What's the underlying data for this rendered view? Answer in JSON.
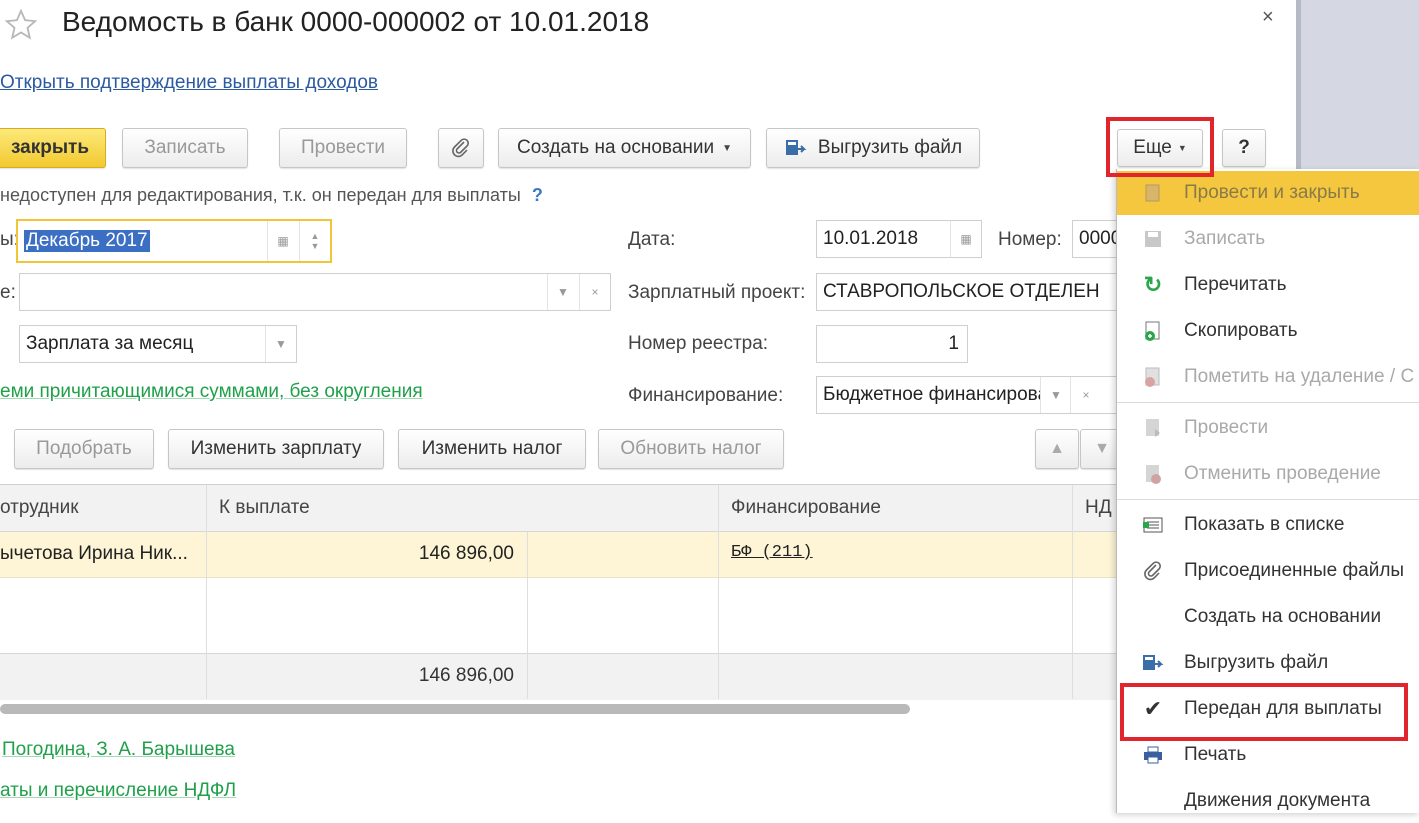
{
  "window": {
    "title": "Ведомость в банк 0000-000002 от 10.01.2018",
    "close_glyph": "×",
    "open_confirmation_link": "Открыть подтверждение выплаты доходов"
  },
  "toolbar": {
    "post_close": "закрыть",
    "save": "Записать",
    "post": "Провести",
    "create_based": "Создать на основании",
    "export_file": "Выгрузить файл",
    "more": "Еще",
    "help": "?"
  },
  "notice": {
    "text": "недоступен для редактирования, т.к. он передан для выплаты",
    "help": "?"
  },
  "form": {
    "period_label": "ы:",
    "period_value": "Декабрь 2017",
    "date_label": "Дата:",
    "date_value": "10.01.2018",
    "number_label": "Номер:",
    "number_value": "0000",
    "org_label": "е:",
    "salary_project_label": "Зарплатный проект:",
    "salary_project_value": "СТАВРОПОЛЬСКОЕ ОТДЕЛЕН",
    "payment_type_value": "Зарплата за месяц",
    "registry_label": "Номер реестра:",
    "registry_value": "1",
    "amounts_link": "еми причитающимися суммами, без округления",
    "financing_label": "Финансирование:",
    "financing_value": "Бюджетное финансирова"
  },
  "table_toolbar": {
    "pick": "Подобрать",
    "change_salary": "Изменить зарплату",
    "change_tax": "Изменить налог",
    "update_tax": "Обновить налог"
  },
  "table": {
    "headers": [
      "отрудник",
      "К выплате",
      "Финансирование",
      "НД"
    ],
    "rows": [
      {
        "employee": "ычетова Ирина Ник...",
        "amount": "146 896,00",
        "financing": "БФ (211)"
      }
    ],
    "total": "146 896,00"
  },
  "footer": {
    "signers_link": "Погодина, З. А. Барышева",
    "payments_link": "аты и перечисление НДФЛ"
  },
  "menu": {
    "items": [
      {
        "label": "Провести и закрыть",
        "icon": "post-close-icon",
        "disabled": true,
        "highlight": true
      },
      {
        "label": "Записать",
        "icon": "save-icon",
        "disabled": true
      },
      {
        "label": "Перечитать",
        "icon": "reload-icon",
        "disabled": false
      },
      {
        "label": "Скопировать",
        "icon": "copy-icon",
        "disabled": false
      },
      {
        "label": "Пометить на удаление / С",
        "icon": "mark-delete-icon",
        "disabled": true
      },
      {
        "label": "Провести",
        "icon": "post-icon",
        "disabled": true
      },
      {
        "label": "Отменить проведение",
        "icon": "unpost-icon",
        "disabled": true
      },
      {
        "label": "Показать в списке",
        "icon": "show-list-icon",
        "disabled": false
      },
      {
        "label": "Присоединенные файлы",
        "icon": "paperclip-icon",
        "disabled": false
      },
      {
        "label": "Создать на основании",
        "icon": "",
        "disabled": false
      },
      {
        "label": "Выгрузить файл",
        "icon": "export-icon",
        "disabled": false
      },
      {
        "label": "Передан для выплаты",
        "icon": "checkmark-icon",
        "disabled": false,
        "checked": true
      },
      {
        "label": "Печать",
        "icon": "printer-icon",
        "disabled": false
      },
      {
        "label": "Движения документа",
        "icon": "",
        "disabled": false
      }
    ]
  },
  "colors": {
    "primary_button": "#f2c92f",
    "selected_row": "#fdf5d5",
    "menu_highlight": "#f5c73e",
    "annotation_red": "#e0262c",
    "green_link": "#20a04a"
  }
}
